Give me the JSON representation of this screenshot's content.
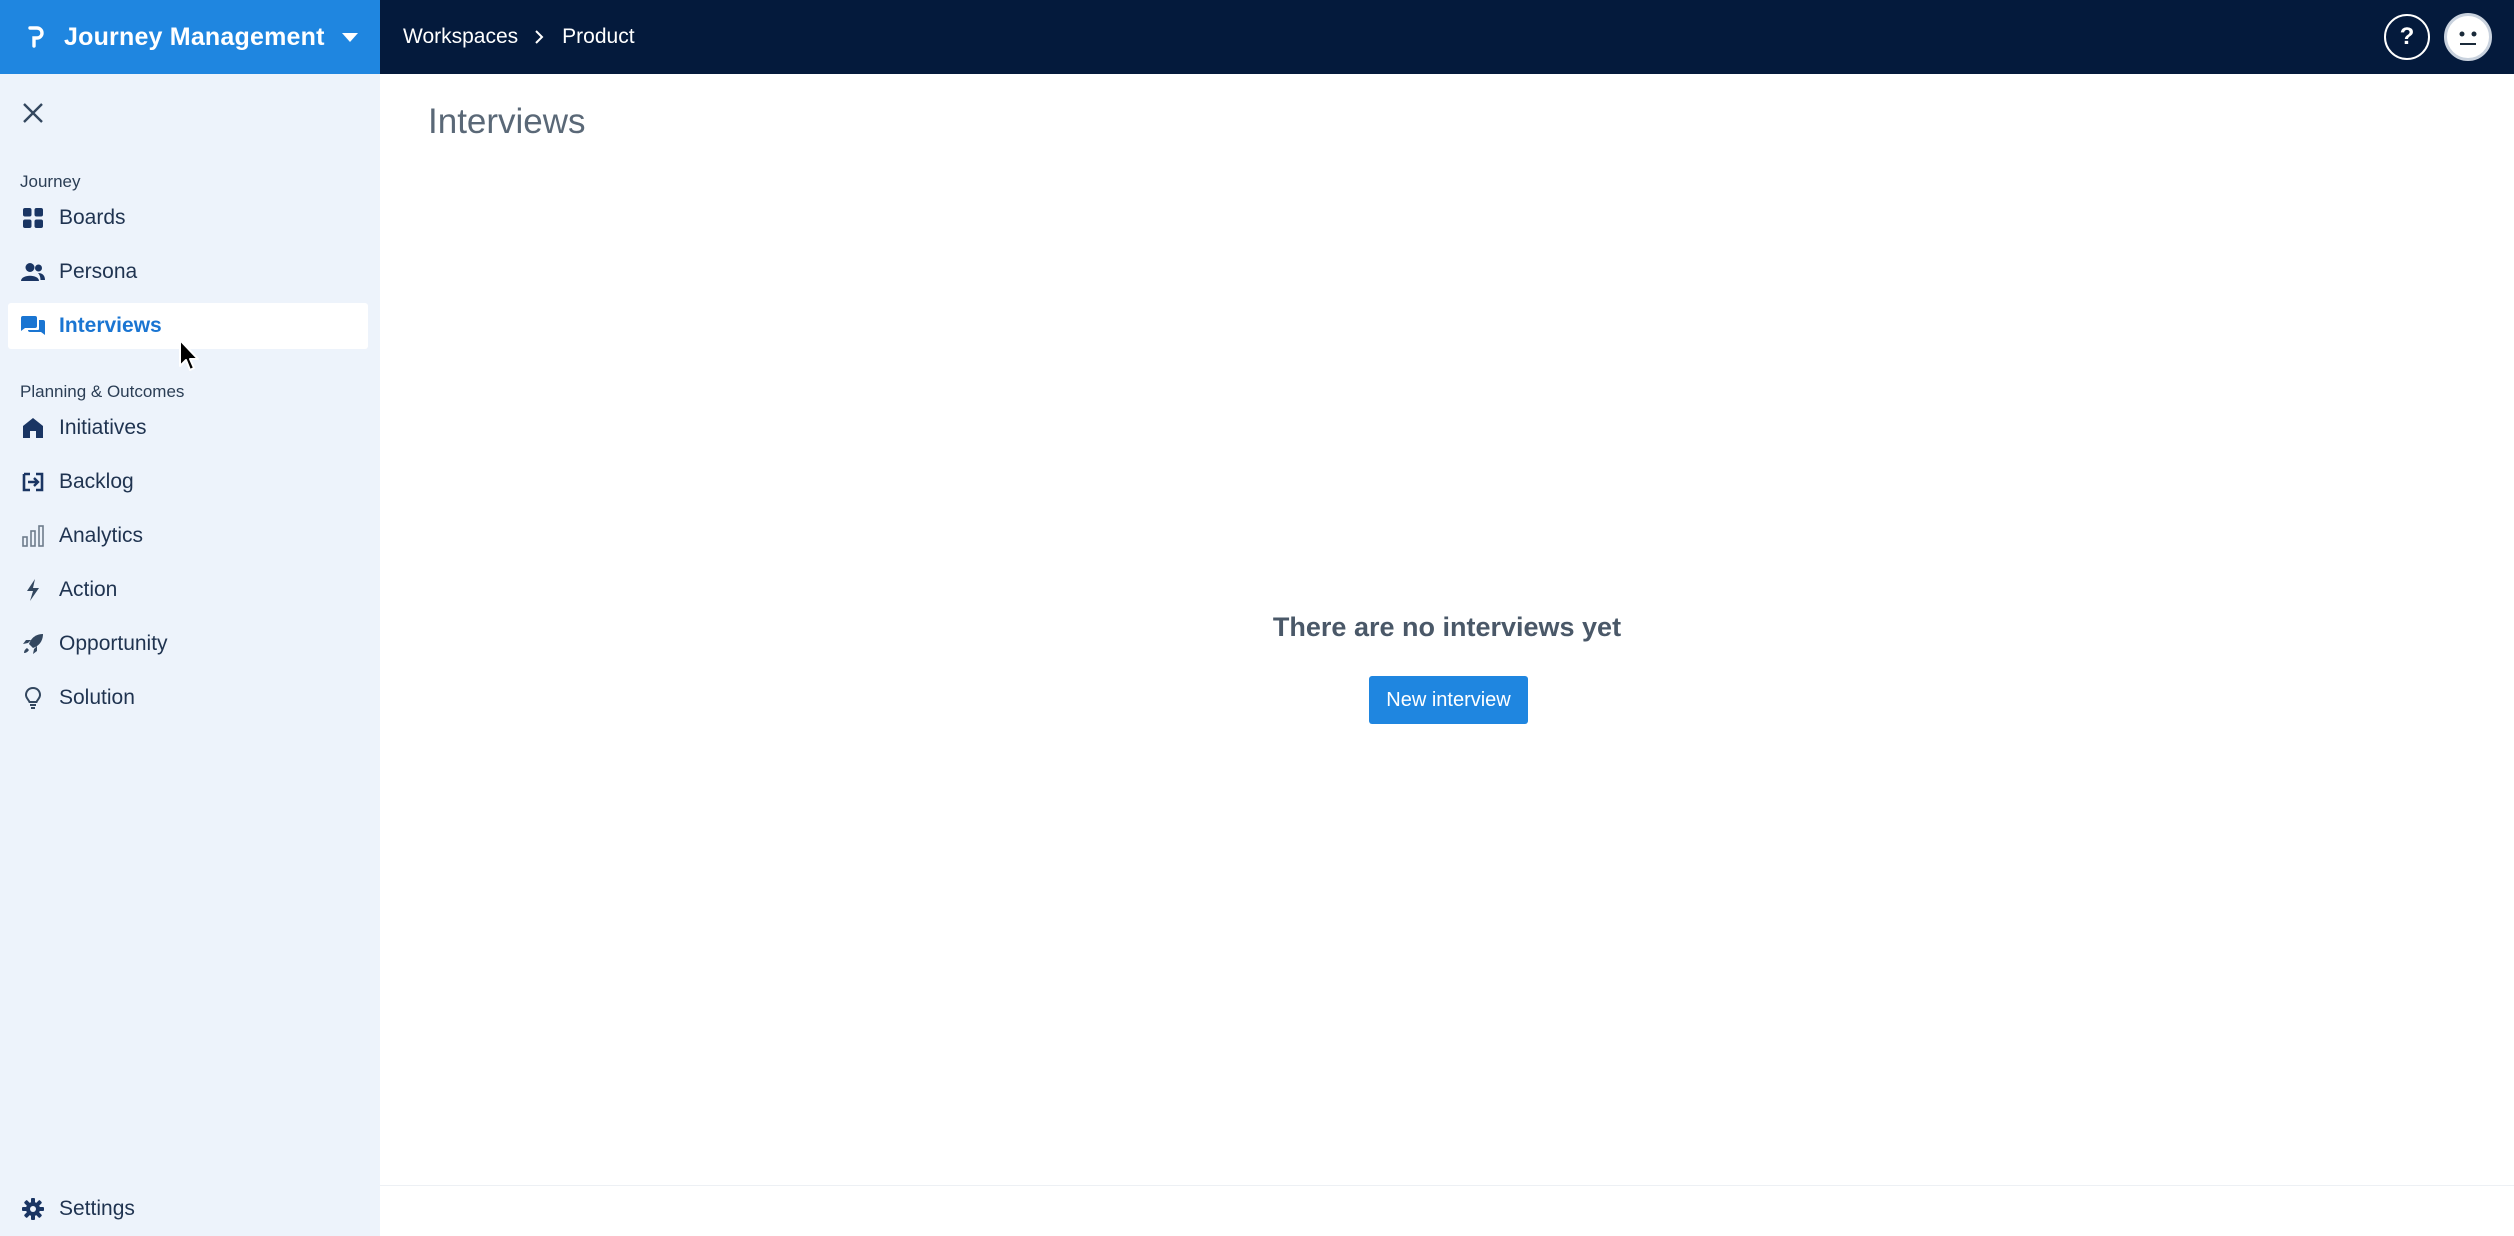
{
  "app": {
    "name": "Journey Management",
    "logo_letter": "P"
  },
  "breadcrumb": {
    "items": [
      "Workspaces",
      "Product"
    ]
  },
  "header": {
    "help_label": "?"
  },
  "sidebar": {
    "sections": [
      {
        "title": "Journey",
        "items": [
          {
            "label": "Boards",
            "icon": "grid-icon"
          },
          {
            "label": "Persona",
            "icon": "users-icon"
          },
          {
            "label": "Interviews",
            "icon": "chat-icon",
            "active": true
          }
        ]
      },
      {
        "title": "Planning & Outcomes",
        "items": [
          {
            "label": "Initiatives",
            "icon": "home-icon"
          },
          {
            "label": "Backlog",
            "icon": "backlog-icon"
          },
          {
            "label": "Analytics",
            "icon": "bar-chart-icon"
          },
          {
            "label": "Action",
            "icon": "bolt-icon"
          },
          {
            "label": "Opportunity",
            "icon": "rocket-icon"
          },
          {
            "label": "Solution",
            "icon": "lightbulb-icon"
          }
        ]
      }
    ],
    "settings_label": "Settings"
  },
  "main": {
    "title": "Interviews",
    "empty_state": {
      "message": "There are no interviews yet",
      "button_label": "New interview"
    }
  },
  "colors": {
    "topbar": "#041a3c",
    "accent": "#1f86e0",
    "sidebar_bg": "#edf3fb",
    "active_text": "#1a75d2"
  }
}
